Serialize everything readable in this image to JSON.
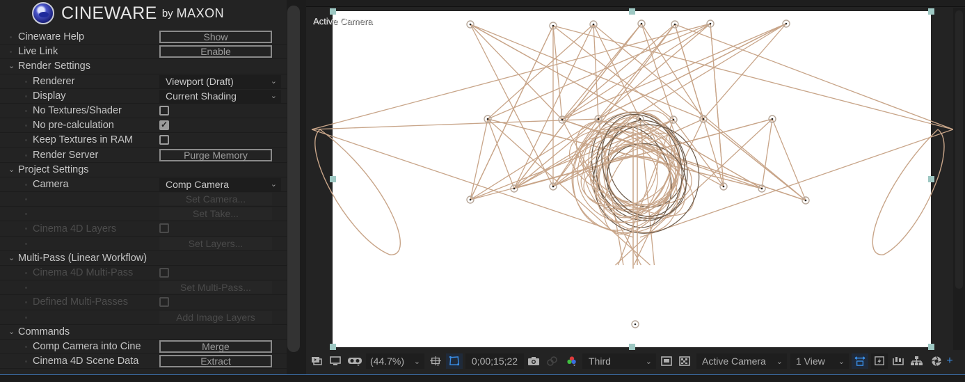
{
  "logo": {
    "icon": "cinema4d-sphere-icon",
    "wordmark": "CINEWARE",
    "by": "by",
    "maxon": "MAXON"
  },
  "rows": [
    {
      "id": "cineware-help",
      "level": 1,
      "label": "Cineware Help",
      "control": "button",
      "value": "Show",
      "disabled": false
    },
    {
      "id": "live-link",
      "level": 1,
      "label": "Live Link",
      "control": "button",
      "value": "Enable",
      "disabled": false
    },
    {
      "id": "render-settings",
      "level": 1,
      "label": "Render Settings",
      "control": "group",
      "expanded": true
    },
    {
      "id": "renderer",
      "level": 2,
      "label": "Renderer",
      "control": "dropdown",
      "value": "Viewport (Draft)"
    },
    {
      "id": "display",
      "level": 2,
      "label": "Display",
      "control": "dropdown",
      "value": "Current Shading"
    },
    {
      "id": "no-textures-shader",
      "level": 2,
      "label": "No Textures/Shader",
      "control": "checkbox",
      "checked": false
    },
    {
      "id": "no-pre-calculation",
      "level": 2,
      "label": "No pre-calculation",
      "control": "checkbox",
      "checked": true
    },
    {
      "id": "keep-textures-in-ram",
      "level": 2,
      "label": "Keep Textures in RAM",
      "control": "checkbox",
      "checked": false
    },
    {
      "id": "render-server",
      "level": 2,
      "label": "Render Server",
      "control": "button",
      "value": "Purge Memory",
      "disabled": false
    },
    {
      "id": "project-settings",
      "level": 1,
      "label": "Project Settings",
      "control": "group",
      "expanded": true
    },
    {
      "id": "camera",
      "level": 2,
      "label": "Camera",
      "control": "dropdown",
      "value": "Comp Camera"
    },
    {
      "id": "set-camera",
      "level": 2,
      "label": "",
      "control": "button",
      "value": "Set Camera...",
      "disabled": true
    },
    {
      "id": "set-take",
      "level": 2,
      "label": "",
      "control": "button",
      "value": "Set Take...",
      "disabled": true
    },
    {
      "id": "cinema-4d-layers",
      "level": 2,
      "label": "Cinema 4D Layers",
      "control": "checkbox",
      "checked": false,
      "disabled": true
    },
    {
      "id": "set-layers",
      "level": 2,
      "label": "",
      "control": "button",
      "value": "Set Layers...",
      "disabled": true
    },
    {
      "id": "multi-pass",
      "level": 1,
      "label": "Multi-Pass (Linear Workflow)",
      "control": "group",
      "expanded": true
    },
    {
      "id": "cinema-4d-multi-pass",
      "level": 2,
      "label": "Cinema 4D Multi-Pass",
      "control": "checkbox",
      "checked": false,
      "disabled": true
    },
    {
      "id": "set-multi-pass",
      "level": 2,
      "label": "",
      "control": "button",
      "value": "Set Multi-Pass...",
      "disabled": true
    },
    {
      "id": "defined-multi-passes",
      "level": 2,
      "label": "Defined Multi-Passes",
      "control": "checkbox",
      "checked": false,
      "disabled": true
    },
    {
      "id": "add-image-layers",
      "level": 2,
      "label": "",
      "control": "button",
      "value": "Add Image Layers",
      "disabled": true
    },
    {
      "id": "commands",
      "level": 1,
      "label": "Commands",
      "control": "group",
      "expanded": true
    },
    {
      "id": "comp-camera-into-cine",
      "level": 2,
      "label": "Comp Camera into Cine",
      "control": "button",
      "value": "Merge",
      "disabled": false
    },
    {
      "id": "cinema-4d-scene-data",
      "level": 2,
      "label": "Cinema 4D Scene Data",
      "control": "button",
      "value": "Extract",
      "disabled": false
    }
  ],
  "viewer": {
    "camera_label": "Active Camera",
    "wire_color": "#c8a589",
    "handle_color": "#9ec8c3"
  },
  "toolbar": {
    "zoom": "(44.7%)",
    "timecode": "0;00;15;22",
    "channel": "Third",
    "camera_view": "Active Camera",
    "views": "1 View",
    "icons": [
      "preview-toggle-icon",
      "monitor-icon",
      "vr-goggles-icon",
      "zoom-dropdown-chevron-icon",
      "region-of-interest-icon",
      "transparency-grid-toggle-icon",
      "snapshot-camera-icon",
      "show-snapshot-icon",
      "color-channels-icon",
      "mask-toggle-icon",
      "checkerboard-icon",
      "reset-exposure-icon",
      "fast-previews-icon",
      "timeline-icon",
      "flowchart-icon",
      "exposure-icon",
      "add-icon"
    ]
  }
}
